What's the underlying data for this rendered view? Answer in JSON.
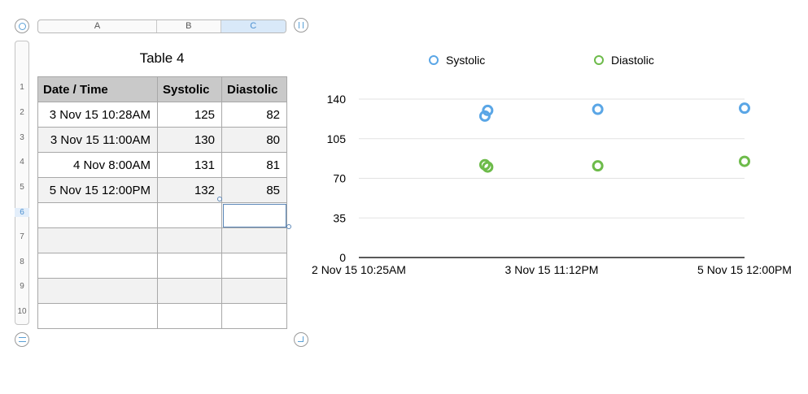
{
  "columns": [
    "A",
    "B",
    "C"
  ],
  "selected_column": "C",
  "rows": [
    "1",
    "2",
    "3",
    "4",
    "5",
    "6",
    "7",
    "8",
    "9",
    "10"
  ],
  "selected_row": "6",
  "table": {
    "title": "Table 4",
    "headers": [
      "Date / Time",
      "Systolic",
      "Diastolic"
    ],
    "data": [
      [
        "3 Nov 15 10:28AM",
        "125",
        "82"
      ],
      [
        "3 Nov 15 11:00AM",
        "130",
        "80"
      ],
      [
        "4 Nov 8:00AM",
        "131",
        "81"
      ],
      [
        "5 Nov 15 12:00PM",
        "132",
        "85"
      ]
    ]
  },
  "chart_data": {
    "type": "scatter",
    "legend": [
      "Systolic",
      "Diastolic"
    ],
    "colors": {
      "Systolic": "#5aa6e6",
      "Diastolic": "#6dbb4a"
    },
    "ylim": [
      0,
      140
    ],
    "yticks": [
      0,
      35,
      70,
      105,
      140
    ],
    "xtick_labels": [
      "2 Nov 15 10:25AM",
      "3 Nov 15 11:12PM",
      "5 Nov 15 12:00PM"
    ],
    "x_range": [
      "2015-11-02 10:25",
      "2015-11-05 12:00"
    ],
    "series": [
      {
        "name": "Systolic",
        "points": [
          {
            "x": "2015-11-03 10:28",
            "y": 125
          },
          {
            "x": "2015-11-03 11:00",
            "y": 130
          },
          {
            "x": "2015-11-04 08:00",
            "y": 131
          },
          {
            "x": "2015-11-05 12:00",
            "y": 132
          }
        ]
      },
      {
        "name": "Diastolic",
        "points": [
          {
            "x": "2015-11-03 10:28",
            "y": 82
          },
          {
            "x": "2015-11-03 11:00",
            "y": 80
          },
          {
            "x": "2015-11-04 08:00",
            "y": 81
          },
          {
            "x": "2015-11-05 12:00",
            "y": 85
          }
        ]
      }
    ],
    "grid": true,
    "legend_position": "top"
  }
}
